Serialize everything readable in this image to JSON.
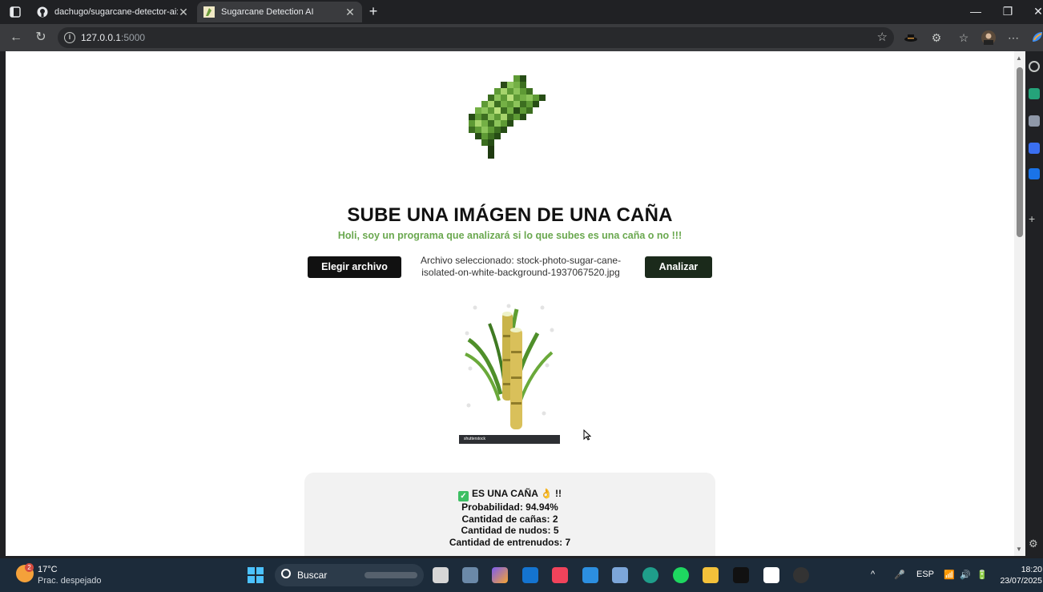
{
  "browser": {
    "tabs": [
      {
        "label": "dachugo/sugarcane-detector-ai: "
      },
      {
        "label": "Sugarcane Detection AI"
      }
    ],
    "url_host": "127.0.0.1",
    "url_port": ":5000"
  },
  "page": {
    "title": "SUBE UNA IMÁGEN DE UNA CAÑA",
    "subtitle": "Holi, soy un programa que analizará si lo que subes es una caña o no !!!",
    "choose_button": "Elegir archivo",
    "file_label": "Archivo seleccionado: stock-photo-sugar-cane-isolated-on-white-background-1937067520.jpg",
    "analyze_button": "Analizar",
    "preview_watermark": "shutterstock",
    "result": {
      "headline": "ES UNA CAÑA 👌 !!",
      "probability": "Probabilidad: 94.94%",
      "canes": "Cantidad de cañas: 2",
      "nodes": "Cantidad de nudos: 5",
      "internodes": "Cantidad de entrenudos: 7"
    }
  },
  "taskbar": {
    "weather_badge": "2",
    "weather_temp": "17°C",
    "weather_desc": "Prac. despejado",
    "search_label": "Buscar",
    "language": "ESP",
    "time": "18:20",
    "date": "23/07/2025"
  },
  "colors": {
    "accent_green": "#6aa84f",
    "analyze_bg": "#1b2a1b",
    "taskbar_bg": "#1c2b3a"
  }
}
